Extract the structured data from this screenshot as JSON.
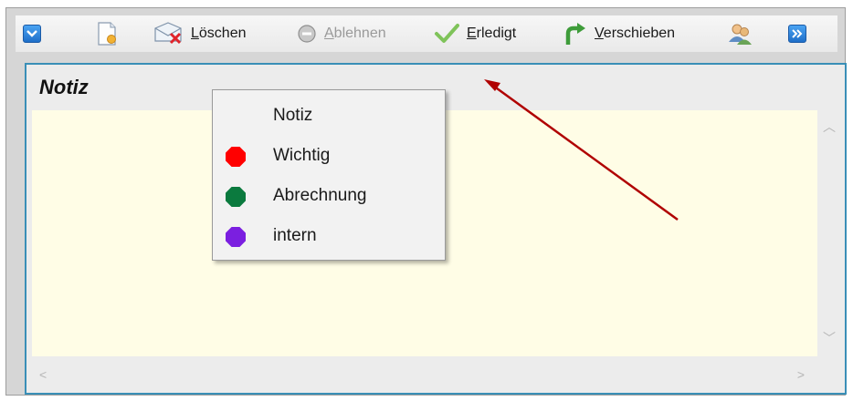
{
  "toolbar": {
    "delete": {
      "accel": "L",
      "rest": "öschen"
    },
    "reject": {
      "accel": "A",
      "rest": "blehnen"
    },
    "done": {
      "accel": "E",
      "rest": "rledigt"
    },
    "move": {
      "accel": "V",
      "rest": "erschieben"
    }
  },
  "note": {
    "title": "Notiz"
  },
  "category_menu": {
    "items": [
      {
        "label": "Notiz",
        "color": null
      },
      {
        "label": "Wichtig",
        "color": "#ff0000"
      },
      {
        "label": "Abrechnung",
        "color": "#0b7a3e"
      },
      {
        "label": "intern",
        "color": "#7b1fe0"
      }
    ]
  },
  "colors": {
    "panel_border": "#3a8fb7",
    "note_background": "#fffde6",
    "annotation_arrow": "#b00000"
  }
}
